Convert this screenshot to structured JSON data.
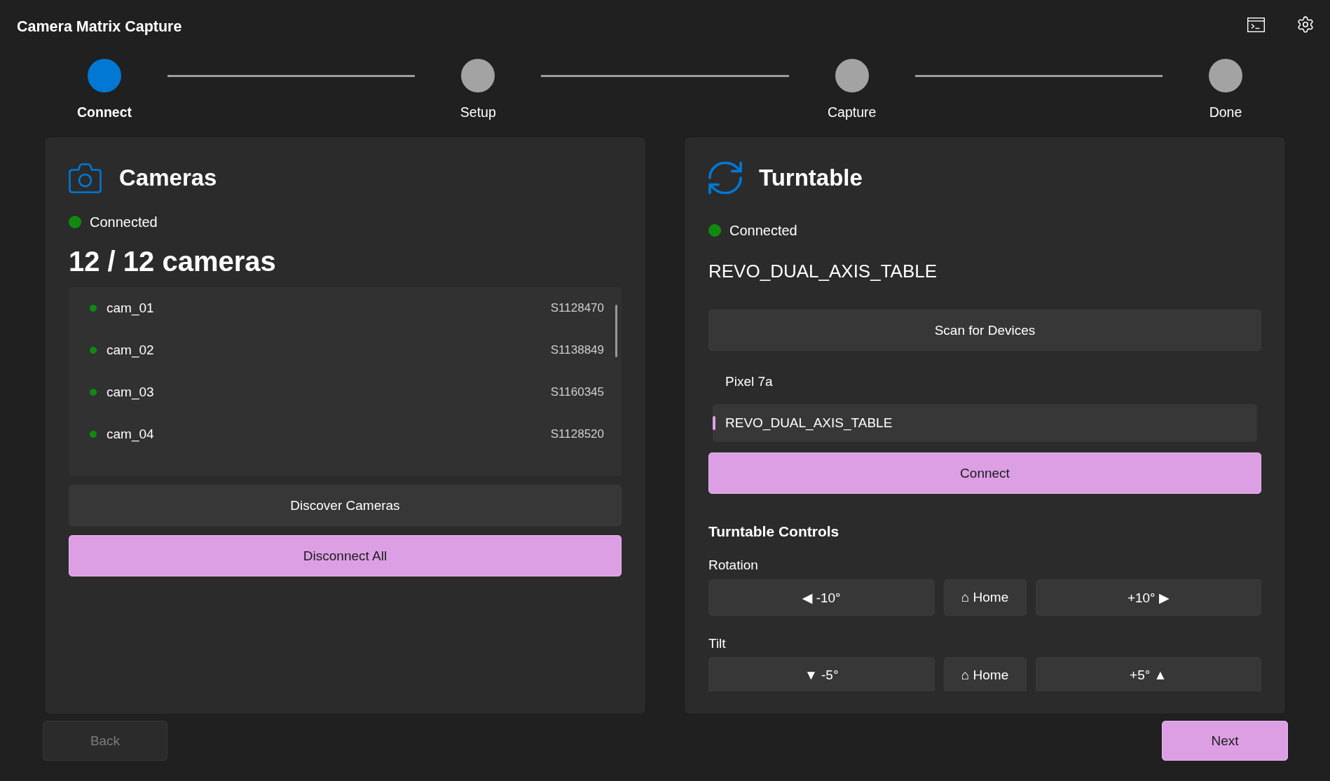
{
  "window": {
    "title": "Camera Matrix Capture"
  },
  "steps": [
    {
      "label": "Connect",
      "selected": true
    },
    {
      "label": "Setup",
      "selected": false
    },
    {
      "label": "Capture",
      "selected": false
    },
    {
      "label": "Done",
      "selected": false
    }
  ],
  "cameras_panel": {
    "title": "Cameras",
    "status": {
      "label": "Connected",
      "connected": true
    },
    "count": "12 / 12 cameras",
    "cameras": [
      {
        "name": "cam_01",
        "serial": "S1128470",
        "connected": true
      },
      {
        "name": "cam_02",
        "serial": "S1138849",
        "connected": true
      },
      {
        "name": "cam_03",
        "serial": "S1160345",
        "connected": true
      },
      {
        "name": "cam_04",
        "serial": "S1128520",
        "connected": true
      }
    ],
    "discover_button": "Discover Cameras",
    "disconnect_button": "Disconnect All"
  },
  "turntable_panel": {
    "title": "Turntable",
    "status": {
      "label": "Connected",
      "connected": true
    },
    "device_name": "REVO_DUAL_AXIS_TABLE",
    "scan_button": "Scan for Devices",
    "devices": [
      {
        "name": "Pixel 7a",
        "selected": false
      },
      {
        "name": "REVO_DUAL_AXIS_TABLE",
        "selected": true
      }
    ],
    "connect_button": "Connect",
    "controls": {
      "title": "Turntable Controls",
      "rotation": {
        "label": "Rotation",
        "decrease": "◀ -10°",
        "home": "⌂ Home",
        "increase": "+10° ▶"
      },
      "tilt": {
        "label": "Tilt",
        "decrease": "▼ -5°",
        "home": "⌂ Home",
        "increase": "+5° ▲"
      }
    }
  },
  "navigation": {
    "back": {
      "label": "Back",
      "disabled": true
    },
    "next": {
      "label": "Next",
      "disabled": false
    }
  }
}
